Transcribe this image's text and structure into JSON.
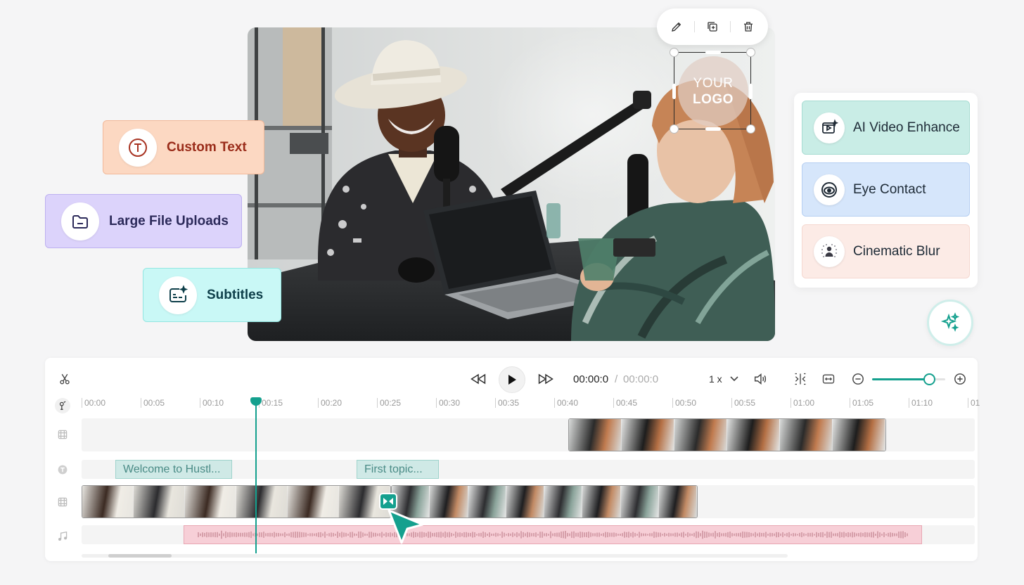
{
  "logo_overlay": {
    "line1": "YOUR",
    "line2": "LOGO"
  },
  "edit_toolbar": [
    {
      "name": "edit",
      "icon": "pencil-icon"
    },
    {
      "name": "duplicate",
      "icon": "duplicate-icon"
    },
    {
      "name": "delete",
      "icon": "trash-icon"
    }
  ],
  "features": {
    "custom_text": {
      "label": "Custom Text",
      "icon": "text-t-icon",
      "color": "#9a2c1a"
    },
    "large_uploads": {
      "label": "Large File Uploads",
      "icon": "folder-icon",
      "color": "#2c2a5a"
    },
    "subtitles": {
      "label": "Subtitles",
      "icon": "subtitles-icon",
      "color": "#0e3f4a"
    }
  },
  "ai_tools": [
    {
      "label": "AI Video Enhance",
      "icon": "video-enhance-icon"
    },
    {
      "label": "Eye Contact",
      "icon": "eye-icon"
    },
    {
      "label": "Cinematic Blur",
      "icon": "blur-person-icon"
    }
  ],
  "transport": {
    "current_time": "00:00:0",
    "separator": "/",
    "total_time": "00:00:0",
    "speed": "1 x",
    "zoom_level": 0.78
  },
  "timeline": {
    "ticks": [
      "00:00",
      "00:05",
      "00:10",
      "00:15",
      "00:20",
      "00:25",
      "00:30",
      "00:35",
      "00:40",
      "00:45",
      "00:50",
      "00:55",
      "01:00",
      "01:05",
      "01:10",
      "01"
    ],
    "text_clips": [
      {
        "label": "Welcome to Hustl..."
      },
      {
        "label": "First topic..."
      }
    ],
    "accent": "#14a08e"
  }
}
